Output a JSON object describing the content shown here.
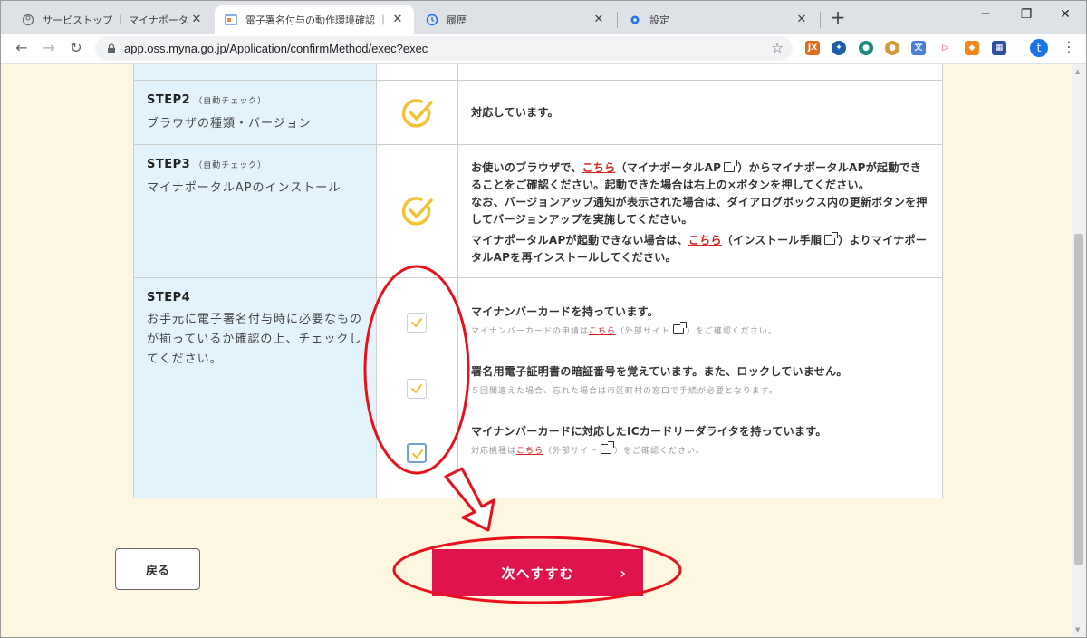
{
  "browser": {
    "tabs": [
      {
        "title": "サービストップ ｜ マイナポータル",
        "favicon": "hand-icon",
        "active": false
      },
      {
        "title": "電子署名付与の動作環境確認 ｜ マ",
        "favicon": "page-icon",
        "active": true
      },
      {
        "title": "履歴",
        "favicon": "history-icon",
        "active": false
      },
      {
        "title": "設定",
        "favicon": "gear-icon",
        "active": false
      }
    ],
    "url": "app.oss.myna.go.jp/Application/confirmMethod/exec?exec",
    "profile_initial": "t"
  },
  "steps": [
    {
      "title": "STEP2",
      "tag": "（自動チェック）",
      "subtitle": "ブラウザの種類・バージョン",
      "description": "対応しています。"
    },
    {
      "title": "STEP3",
      "tag": "（自動チェック）",
      "subtitle": "マイナポータルAPのインストール",
      "line1_pre": "お使いのブラウザで、",
      "link1": "こちら",
      "line1_post": "（マイナポータルAP",
      "line1_end": "）からマイナポータルAPが起動できることをご確認ください。起動できた場合は右上の×ボタンを押してください。",
      "line2": "なお、バージョンアップ通知が表示された場合は、ダイアログボックス内の更新ボタンを押してバージョンアップを実施してください。",
      "line3_pre": "マイナポータルAPが起動できない場合は、",
      "link2": "こちら",
      "line3_mid": "（インストール手順",
      "line3_end": "）よりマイナポータルAPを再インストールしてください。"
    },
    {
      "title": "STEP4",
      "subtitle": "お手元に電子署名付与時に必要なものが揃っているか確認の上、チェックしてください。",
      "items": [
        {
          "label": "マイナンバーカードを持っています。",
          "note_pre": "マイナンバーカードの申請は",
          "note_link": "こちら",
          "note_mid": "（外部サイト",
          "note_end": "）をご確認ください。",
          "checked": true
        },
        {
          "label": "署名用電子証明書の暗証番号を覚えています。また、ロックしていません。",
          "note": "５回間違えた場合、忘れた場合は市区町村の窓口で手続が必要となります。",
          "checked": true
        },
        {
          "label": "マイナンバーカードに対応したICカードリーダライタを持っています。",
          "note_pre": "対応機種は",
          "note_link": "こちら",
          "note_mid": "（外部サイト",
          "note_end": "）をご確認ください。",
          "checked": true
        }
      ]
    }
  ],
  "buttons": {
    "back": "戻る",
    "next": "次へすすむ",
    "next_chevron": "›"
  },
  "colors": {
    "accent": "#e0144c",
    "page_bg": "#fdf6e0",
    "label_bg": "#e3f3fb",
    "check": "#f2c230",
    "annotation": "#e8101a"
  }
}
